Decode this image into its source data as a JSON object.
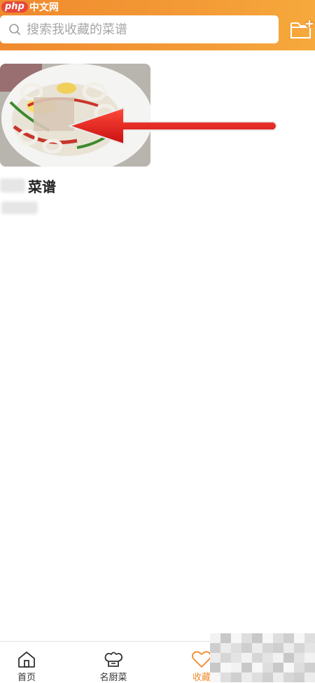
{
  "watermark": {
    "logo": "php",
    "text": "中文网"
  },
  "search": {
    "placeholder": "搜索我收藏的菜谱"
  },
  "collection": {
    "items": [
      {
        "title_suffix": "菜谱"
      }
    ]
  },
  "tabbar": {
    "tabs": [
      {
        "label": "首页",
        "icon": "home-icon"
      },
      {
        "label": "名厨菜",
        "icon": "chef-hat-icon"
      },
      {
        "label": "收藏",
        "icon": "heart-icon",
        "active": true
      }
    ]
  },
  "colors": {
    "accent": "#f08a2e",
    "header_start": "#f08a2e",
    "header_end": "#f6a93c"
  }
}
